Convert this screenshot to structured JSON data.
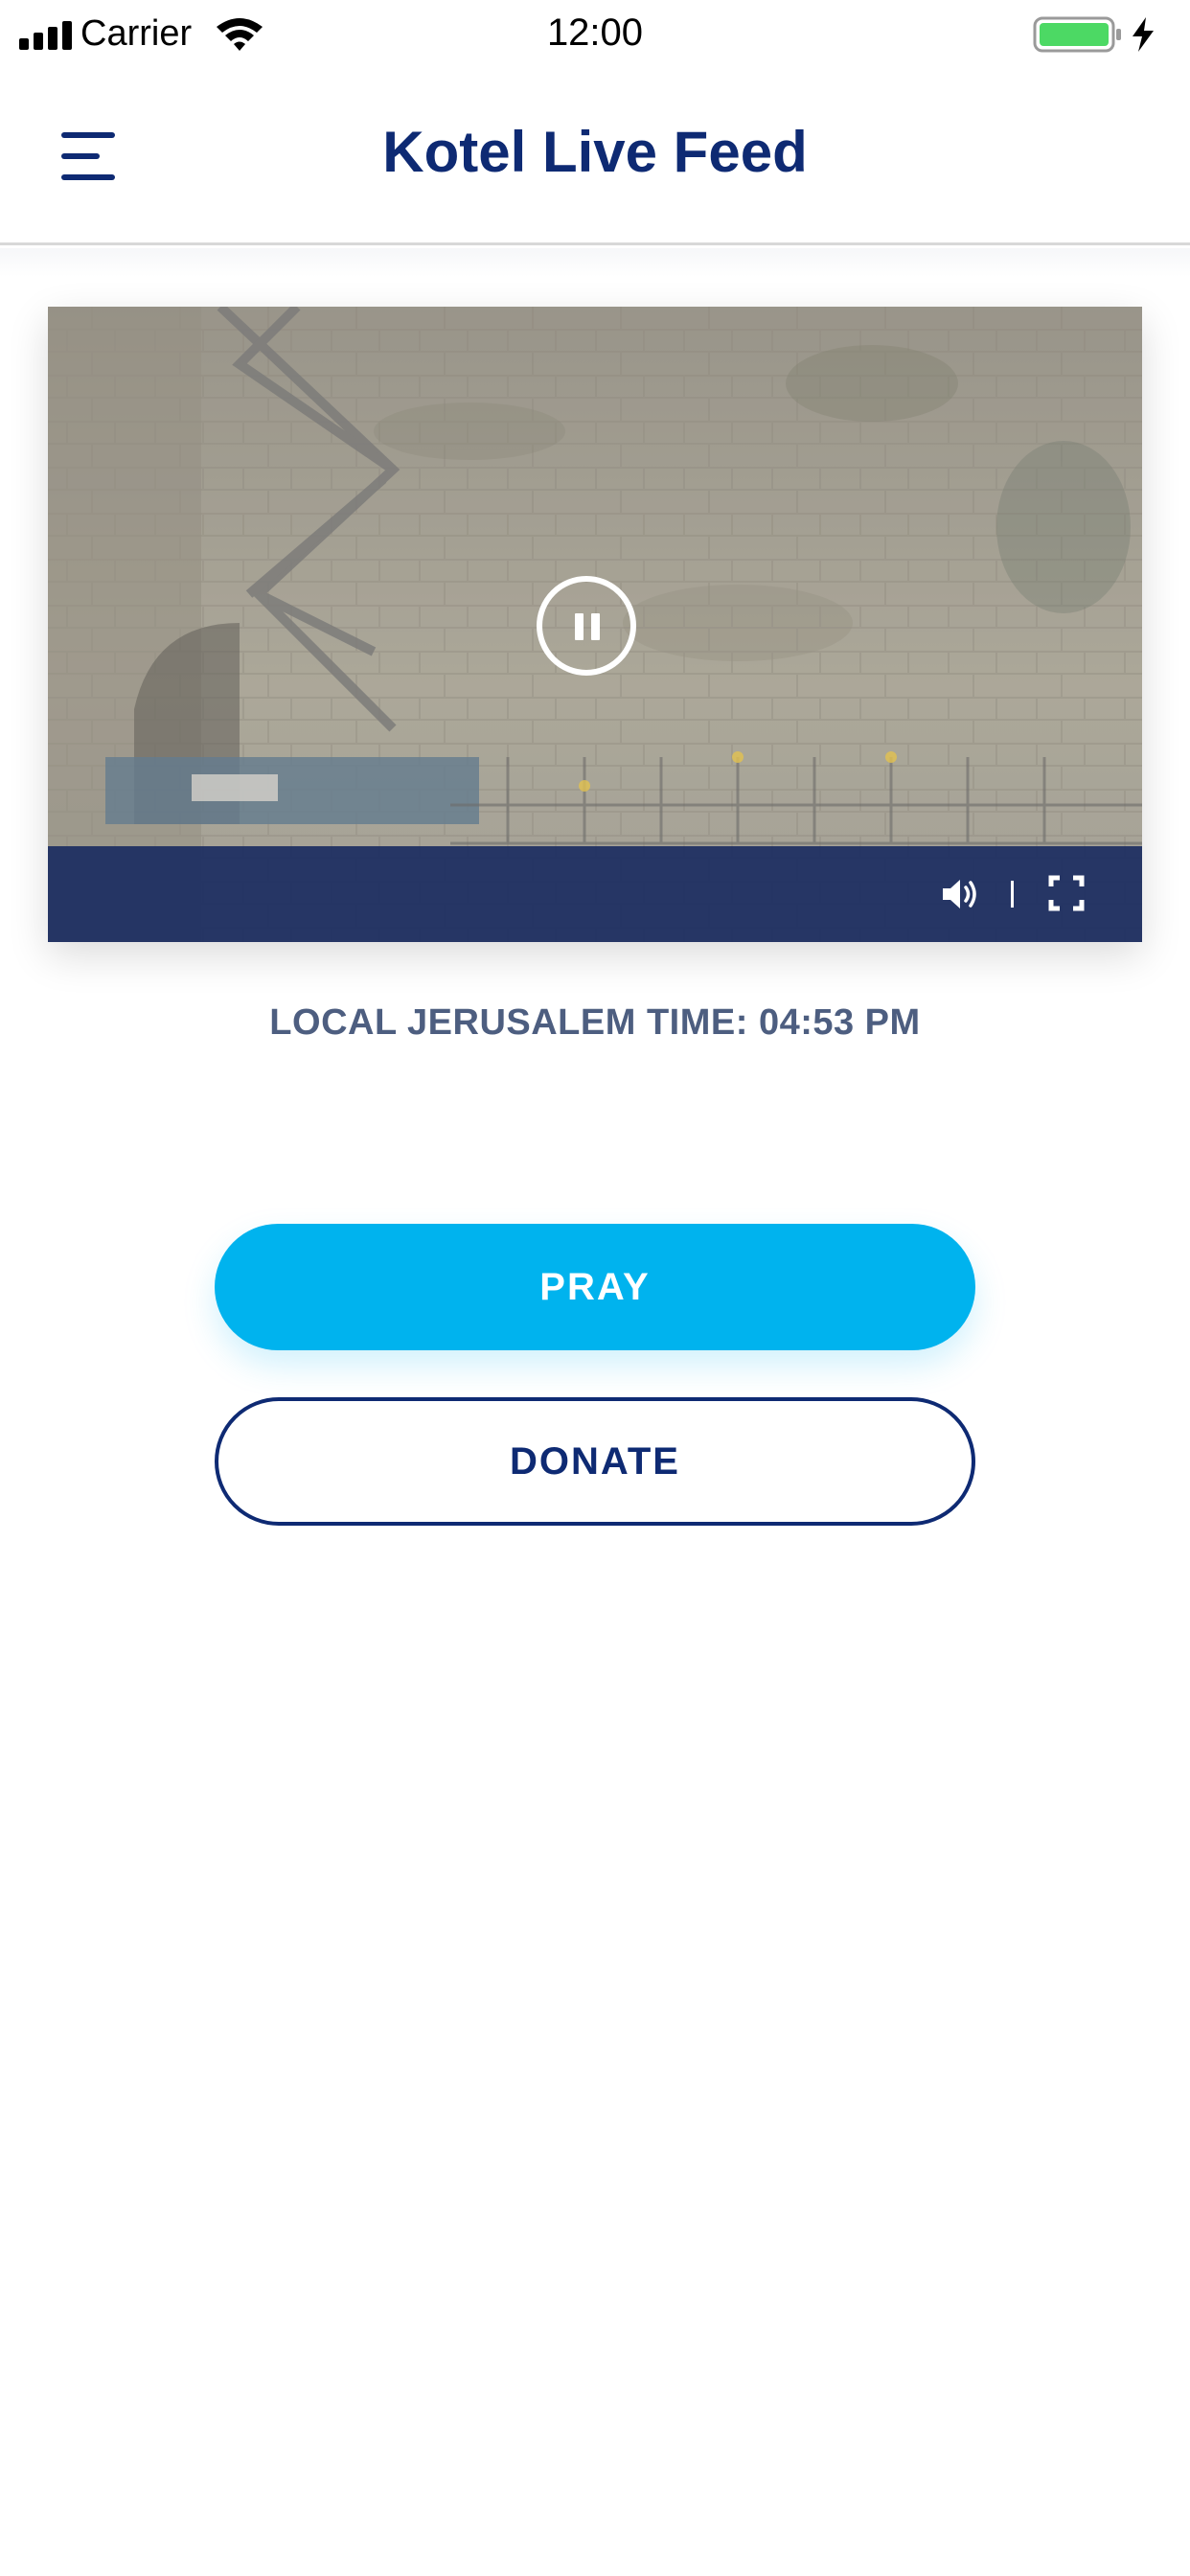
{
  "status_bar": {
    "carrier": "Carrier",
    "time": "12:00",
    "battery_color": "#4cd964"
  },
  "header": {
    "title": "Kotel Live Feed",
    "menu_icon": "hamburger-icon",
    "title_color": "#0e2a73"
  },
  "video": {
    "state_icon": "pause-icon",
    "controls": {
      "volume_icon": "volume-icon",
      "fullscreen_icon": "fullscreen-icon"
    },
    "controls_bar_color": "#1b2d61"
  },
  "time_label": "LOCAL JERUSALEM TIME: 04:53 PM",
  "actions": {
    "pray_label": "PRAY",
    "donate_label": "DONATE",
    "pray_color": "#00b3ee",
    "donate_border_color": "#0e2a73"
  }
}
